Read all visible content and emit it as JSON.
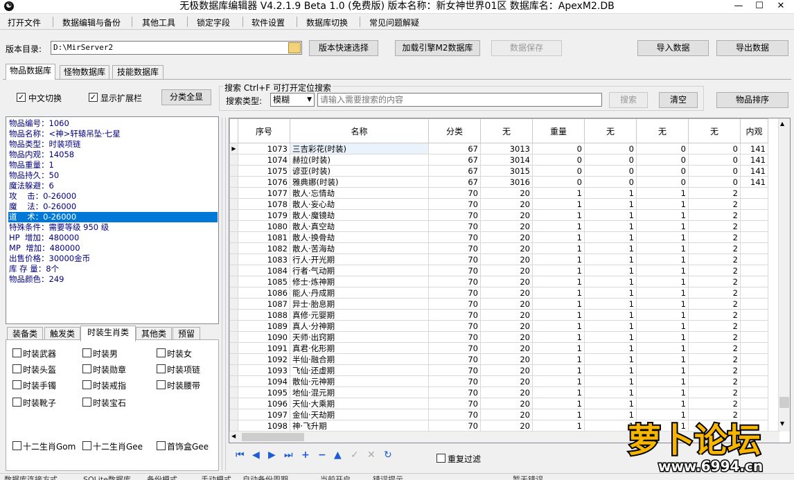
{
  "title": "无极数据库编辑器 V4.2.1.9   Beta 1.0 (免费版)   版本名称：新女神世界01区     数据库名：ApexM2.DB",
  "window_controls": {
    "minimize": "—",
    "maximize": "☐",
    "close": "✕"
  },
  "menu": [
    "打开文件",
    "数据编辑与备份",
    "其他工具",
    "锁定字段",
    "软件设置",
    "数据库切换",
    "常见问题解疑"
  ],
  "toolbar": {
    "version_dir_label": "版本目录:",
    "version_dir_value": "D:\\MirServer2",
    "quick_select": "版本快速选择",
    "load_engine": "加载引擎M2数据库",
    "save_data": "数据保存",
    "import_data": "导入数据",
    "export_data": "导出数据"
  },
  "db_tabs": [
    "物品数据库",
    "怪物数据库",
    "技能数据库"
  ],
  "options": {
    "chinese_switch": "中文切换",
    "show_ext": "显示扩展栏",
    "show_all_categories": "分类全显"
  },
  "search": {
    "title": "搜索   Ctrl+F 可打开定位搜索",
    "type_label": "搜索类型:",
    "type_value": "模糊",
    "placeholder": "请输入需要搜索的内容",
    "search_btn": "搜索",
    "clear_btn": "清空",
    "sort_btn": "物品排序"
  },
  "item_info": [
    "物品编号：1060",
    "物品名称：<神>轩辕吊坠·七星",
    "物品类型：时装项链",
    "物品内观：14058",
    "物品重量：1",
    "物品持久：50",
    "魔法躲避：6",
    "攻    击：0-26000",
    "魔    法：0-26000",
    "道    术：0-26000",
    "特殊条件：需要等级 950 级",
    "HP  增加：480000",
    "MP  增加：480000",
    "出售价格：30000金币",
    "库 存 量：8个",
    "物品颜色：249"
  ],
  "category_tabs": [
    "装备类",
    "触发类",
    "时装生肖类",
    "其他类",
    "预留"
  ],
  "category_checks": [
    [
      "时装武器",
      "时装男",
      "时装女"
    ],
    [
      "时装头盔",
      "时装勋章",
      "时装项链"
    ],
    [
      "时装手镯",
      "时装戒指",
      "时装腰带"
    ],
    [
      "时装靴子",
      "时装宝石",
      ""
    ]
  ],
  "category_checks_bottom": [
    "十二生肖Gom",
    "十二生肖Gee",
    "首饰盒Gee"
  ],
  "grid": {
    "columns": [
      "序号",
      "名称",
      "分类",
      "无",
      "重量",
      "无",
      "无",
      "无",
      "内观"
    ],
    "rows": [
      [
        "1073",
        "三吉彩花(时装)",
        "67",
        "3013",
        "0",
        "0",
        "0",
        "0",
        "141"
      ],
      [
        "1074",
        "赫拉(时装)",
        "67",
        "3014",
        "0",
        "0",
        "0",
        "0",
        "141"
      ],
      [
        "1075",
        "谚亚(时装)",
        "67",
        "3015",
        "0",
        "0",
        "0",
        "0",
        "141"
      ],
      [
        "1076",
        "雅典娜(时装)",
        "67",
        "3016",
        "0",
        "0",
        "0",
        "0",
        "141"
      ],
      [
        "1077",
        "散人·忘情劫",
        "70",
        "20",
        "1",
        "1",
        "1",
        "2",
        ""
      ],
      [
        "1078",
        "散人·妄心劫",
        "70",
        "20",
        "1",
        "1",
        "1",
        "2",
        ""
      ],
      [
        "1079",
        "散人·魔镜劫",
        "70",
        "20",
        "1",
        "1",
        "1",
        "2",
        ""
      ],
      [
        "1080",
        "散人·真空劫",
        "70",
        "20",
        "1",
        "1",
        "1",
        "2",
        ""
      ],
      [
        "1081",
        "散人·换骨劫",
        "70",
        "20",
        "1",
        "1",
        "1",
        "2",
        ""
      ],
      [
        "1082",
        "散人·苦海劫",
        "70",
        "20",
        "1",
        "1",
        "1",
        "2",
        ""
      ],
      [
        "1083",
        "行人·开光期",
        "70",
        "20",
        "1",
        "1",
        "1",
        "2",
        ""
      ],
      [
        "1084",
        "行者·气动期",
        "70",
        "20",
        "1",
        "1",
        "1",
        "2",
        ""
      ],
      [
        "1085",
        "修士·炼神期",
        "70",
        "20",
        "1",
        "1",
        "1",
        "2",
        ""
      ],
      [
        "1086",
        "能人·丹成期",
        "70",
        "20",
        "1",
        "1",
        "1",
        "2",
        ""
      ],
      [
        "1087",
        "异士·胎息期",
        "70",
        "20",
        "1",
        "1",
        "1",
        "2",
        ""
      ],
      [
        "1088",
        "真修·元婴期",
        "70",
        "20",
        "1",
        "1",
        "1",
        "2",
        ""
      ],
      [
        "1089",
        "真人·分神期",
        "70",
        "20",
        "1",
        "1",
        "1",
        "2",
        ""
      ],
      [
        "1090",
        "天师·出窍期",
        "70",
        "20",
        "1",
        "1",
        "1",
        "2",
        ""
      ],
      [
        "1091",
        "真君·化形期",
        "70",
        "20",
        "1",
        "1",
        "1",
        "2",
        ""
      ],
      [
        "1092",
        "半仙·融合期",
        "70",
        "20",
        "1",
        "1",
        "1",
        "2",
        ""
      ],
      [
        "1093",
        "飞仙·还虚期",
        "70",
        "20",
        "1",
        "1",
        "1",
        "2",
        ""
      ],
      [
        "1094",
        "散仙·元神期",
        "70",
        "20",
        "1",
        "1",
        "1",
        "2",
        ""
      ],
      [
        "1095",
        "地仙·混元期",
        "70",
        "20",
        "1",
        "1",
        "1",
        "2",
        ""
      ],
      [
        "1096",
        "天仙·大乘期",
        "70",
        "20",
        "1",
        "1",
        "1",
        "2",
        ""
      ],
      [
        "1097",
        "金仙·天劫期",
        "70",
        "20",
        "1",
        "1",
        "1",
        "2",
        ""
      ],
      [
        "1098",
        "神·飞升期",
        "70",
        "20",
        "1",
        "1",
        "1",
        "2",
        ""
      ]
    ]
  },
  "nav_icons": [
    "first-icon",
    "prev-icon",
    "next-icon",
    "last-icon",
    "add-icon",
    "delete-icon",
    "up-icon",
    "confirm-icon",
    "cancel-icon",
    "refresh-icon"
  ],
  "repeat_filter": "重复过滤",
  "watermark": {
    "text": "萝卜论坛",
    "url": "www.6994.cn"
  },
  "status": [
    "数据库连接方式",
    "SQLite数据库",
    "备份模式",
    "手动模式",
    "自动备份周期",
    "当前开启",
    "错误提示",
    "暂无错误"
  ]
}
